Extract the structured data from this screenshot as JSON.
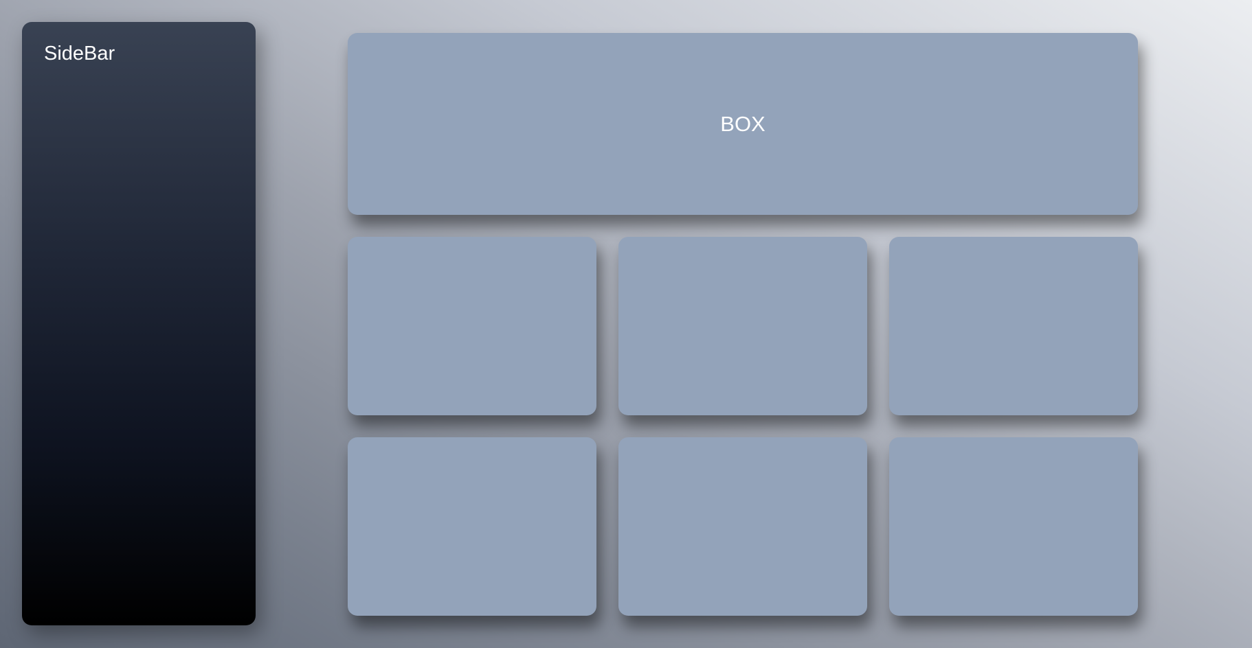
{
  "sidebar": {
    "title": "SideBar"
  },
  "main": {
    "hero": {
      "label": "BOX"
    }
  },
  "colors": {
    "sidebar_top": "#394253",
    "sidebar_bottom": "#000000",
    "box": "#93a3ba",
    "text": "#ffffff"
  }
}
